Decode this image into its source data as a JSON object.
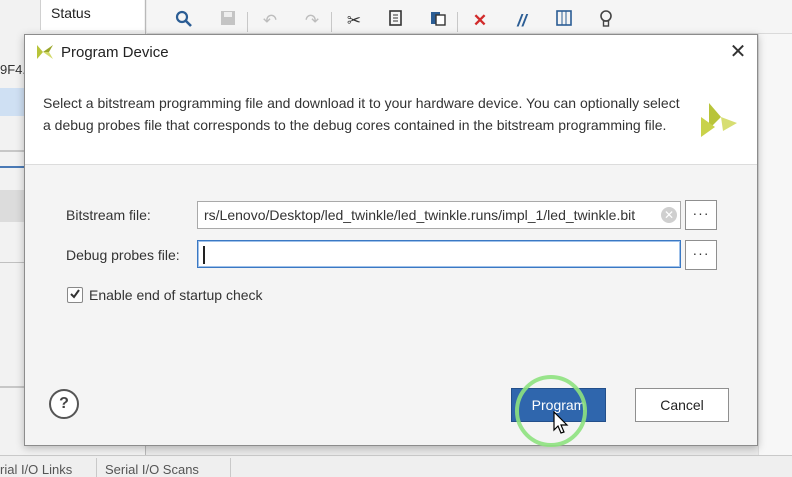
{
  "background": {
    "status_header": "Status",
    "left_fragment": "9F4.",
    "bottom_tabs": [
      "rial I/O Links",
      "Serial I/O Scans"
    ],
    "toolbar_icons": [
      "search-icon",
      "save-icon",
      "undo-icon",
      "redo-icon",
      "cut-icon",
      "copy-icon",
      "paste-icon",
      "delete-icon",
      "comment-icon",
      "columns-icon",
      "lightbulb-icon"
    ]
  },
  "dialog": {
    "title": "Program Device",
    "close_glyph": "✕",
    "description": "Select a bitstream programming file and download it to your hardware device. You can optionally select a debug probes file that corresponds to the debug cores contained in the bitstream programming file.",
    "bitstream": {
      "label": "Bitstream file:",
      "value": "rs/Lenovo/Desktop/led_twinkle/led_twinkle.runs/impl_1/led_twinkle.bit",
      "browse_label": "···"
    },
    "debug_probes": {
      "label": "Debug probes file:",
      "value": "",
      "browse_label": "···"
    },
    "startup_check": {
      "label": "Enable end of startup check",
      "checked": true
    },
    "help_label": "?",
    "program_label": "Program",
    "cancel_label": "Cancel"
  },
  "colors": {
    "accent": "#2f66ad",
    "logo": "#b8c43a",
    "click_ring": "#8ee27f"
  }
}
